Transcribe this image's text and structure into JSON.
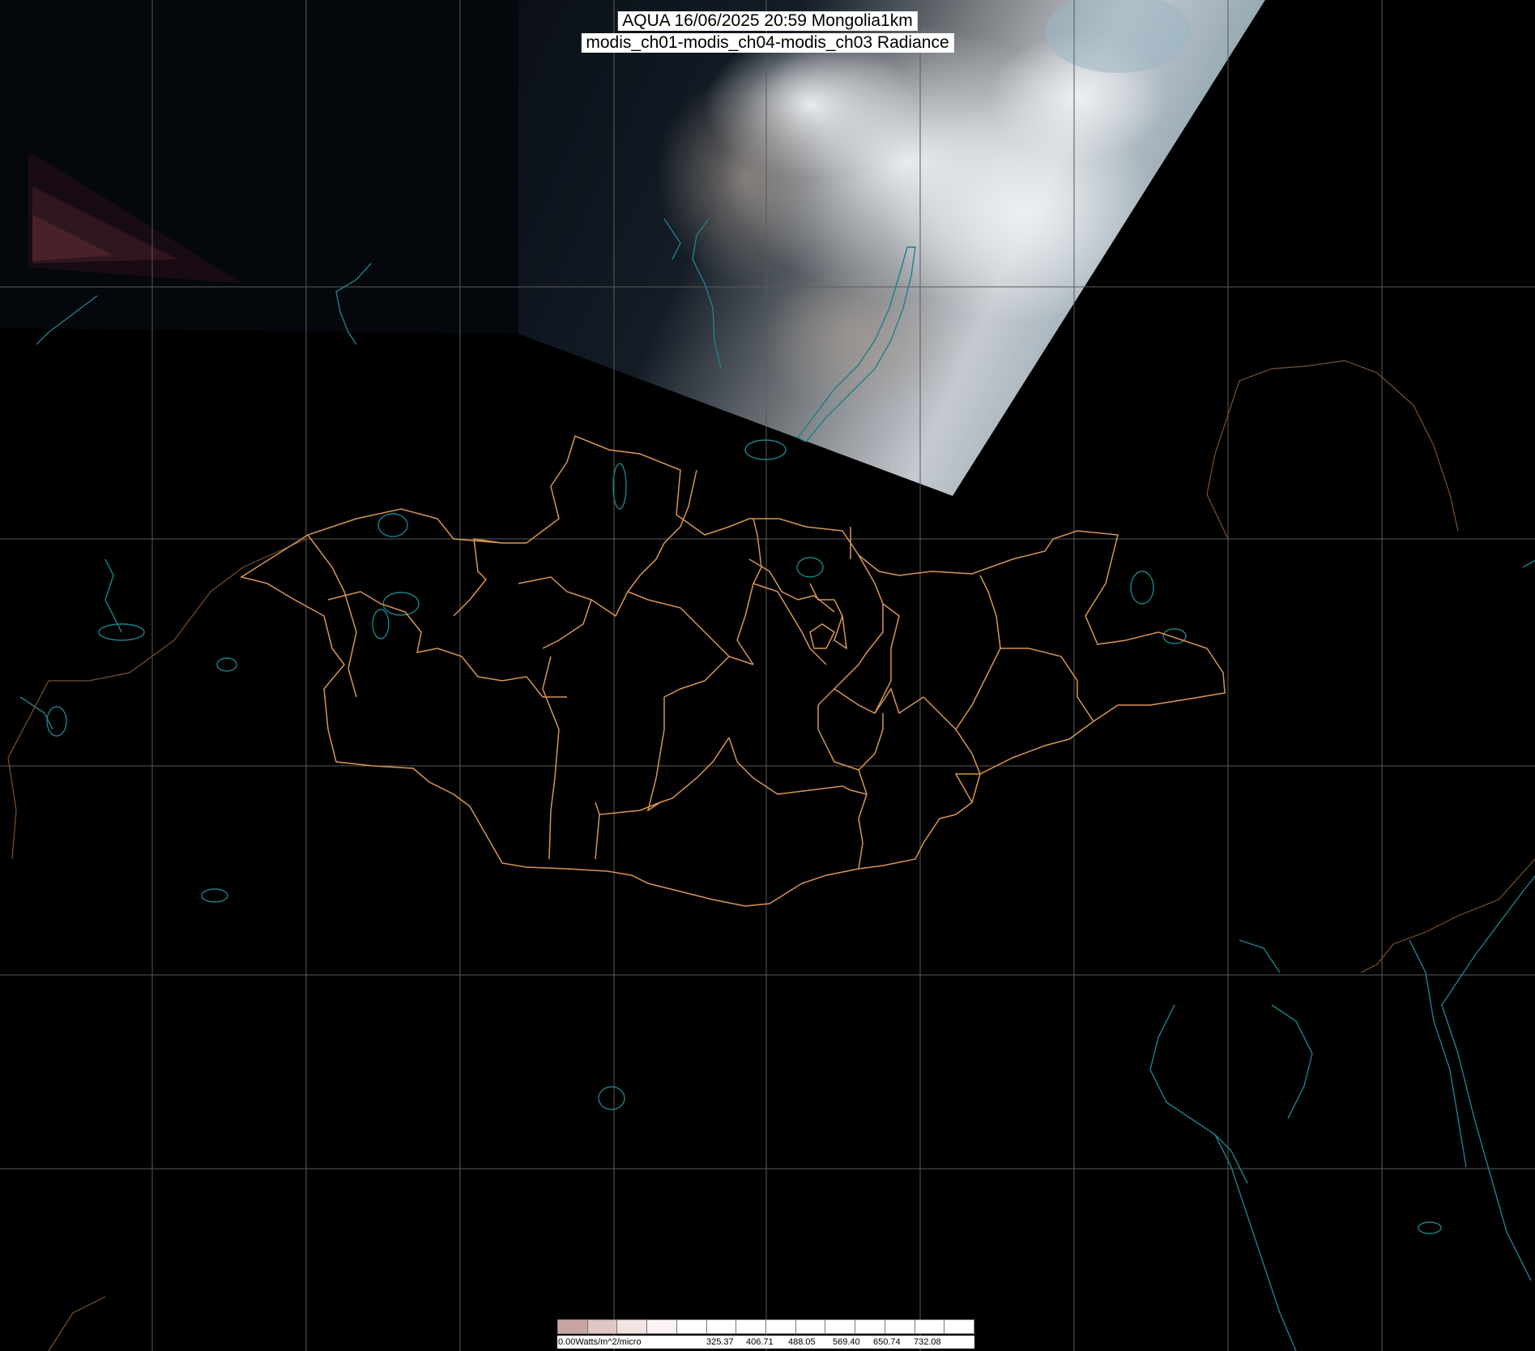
{
  "title": {
    "line1": "AQUA 16/06/2025 20:59 Mongolia1km",
    "line2": "modis_ch01-modis_ch04-modis_ch03 Radiance"
  },
  "colorbar": {
    "unit_label": "0.00Watts/m^2/micro",
    "tick_labels": [
      "325.37",
      "406.71",
      "488.05",
      "569.40",
      "650.74",
      "732.08"
    ],
    "gradient_start_color": "#c9a5a2",
    "gradient_end_color": "#ffffff"
  },
  "colors": {
    "background": "#000000",
    "graticule": "#5a5a5a",
    "coastline": "#1f7f88",
    "province_border": "#d79650",
    "cloud": "#d8dde3",
    "land_dark": "#16202b"
  }
}
